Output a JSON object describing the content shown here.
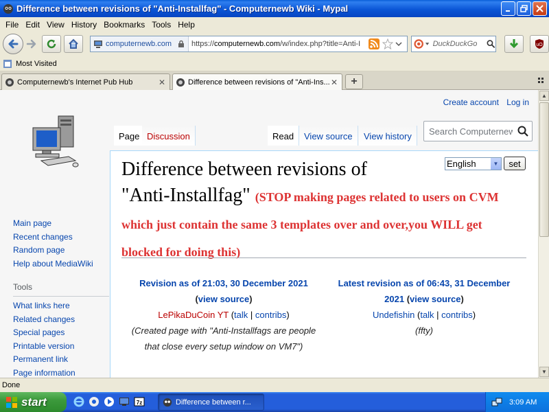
{
  "window": {
    "title": "Difference between revisions of \"Anti-Installfag\" - Computernewb Wiki - Mypal"
  },
  "menu": [
    "File",
    "Edit",
    "View",
    "History",
    "Bookmarks",
    "Tools",
    "Help"
  ],
  "toolbar": {
    "identity_domain": "computernewb.com",
    "url_prefix": "https://",
    "url_host": "computernewb.com",
    "url_path": "/w/index.php?title=Anti-I",
    "search_placeholder": "DuckDuckGo"
  },
  "bookmarks": {
    "most_visited": "Most Visited"
  },
  "tabs": [
    {
      "label": "Computernewb's Internet Pub Hub"
    },
    {
      "label": "Difference between revisions of \"Anti-Ins..."
    }
  ],
  "wiki": {
    "personal": {
      "create_account": "Create account",
      "log_in": "Log in"
    },
    "tabs": {
      "page": "Page",
      "discussion": "Discussion",
      "read": "Read",
      "view_source": "View source",
      "view_history": "View history"
    },
    "search_placeholder": "Search Computernewb",
    "nav": [
      "Main page",
      "Recent changes",
      "Random page",
      "Help about MediaWiki"
    ],
    "tools_heading": "Tools",
    "tools": [
      "What links here",
      "Related changes",
      "Special pages",
      "Printable version",
      "Permanent link",
      "Page information"
    ],
    "heading_line1": "Difference between revisions of",
    "heading_line2": "\"Anti-Installfag\"",
    "summary": "(STOP making pages related to users on CVM which just contain the same 3 templates over and over,you WILL get blocked for doing this)",
    "language": {
      "selected": "English",
      "set_label": "set"
    },
    "left": {
      "rev_title": "Revision as of 21:03, 30 December 2021",
      "view_source": "view source",
      "user": "LePikaDuCoin YT",
      "talk": "talk",
      "contribs": "contribs",
      "summary": "(Created page with \"Anti-Installfags are people that close every setup window on VM7\")"
    },
    "right": {
      "rev_title": "Latest revision as of 06:43, 31 December 2021",
      "view_source": "view source",
      "user": "Undefishin",
      "talk": "talk",
      "contribs": "contribs",
      "summary": "(ffty)"
    }
  },
  "status": "Done",
  "taskbar": {
    "start": "start",
    "task_label": "Difference between r...",
    "clock": "3:09 AM"
  }
}
